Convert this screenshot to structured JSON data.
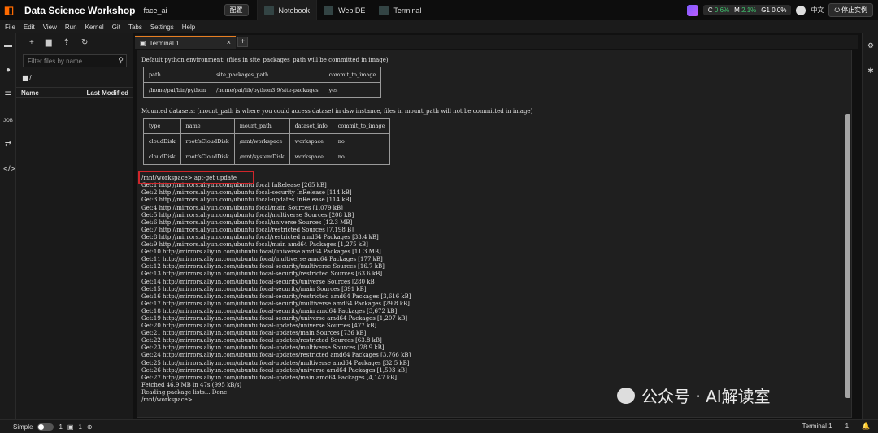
{
  "topbar": {
    "app_title": "Data Science Workshop",
    "workspace": "face_ai",
    "config_button": "配置",
    "tabs": [
      {
        "label": "Notebook",
        "active": true
      },
      {
        "label": "WebIDE",
        "active": false
      },
      {
        "label": "Terminal",
        "active": false
      }
    ],
    "metrics": {
      "c_label": "C",
      "c_value": "0.6%",
      "m_label": "M",
      "m_value": "2.1%",
      "g_label": "G",
      "g_value": "0.0%"
    },
    "language": "中文",
    "stop_button": "停止实例"
  },
  "menu": [
    "File",
    "Edit",
    "View",
    "Run",
    "Kernel",
    "Git",
    "Tabs",
    "Settings",
    "Help"
  ],
  "file_browser": {
    "filter_placeholder": "Filter files by name",
    "path": "/",
    "col_name": "Name",
    "col_modified": "Last Modified"
  },
  "terminal_tab": {
    "label": "Terminal 1"
  },
  "terminal": {
    "env_header": "Default python environment: (files in site_packages_path will be committed in image)",
    "env_table": [
      [
        "path",
        "site_packages_path",
        "commit_to_image"
      ],
      [
        "/home/pai/bin/python",
        "/home/pai/lib/python3.9/site-packages",
        "yes"
      ]
    ],
    "mount_header": "Mounted datasets: (mount_path is where you could access dataset in dsw instance, files in mount_path will not be committed in image)",
    "mount_table": [
      [
        "type",
        "name",
        "mount_path",
        "dataset_info",
        "commit_to_image"
      ],
      [
        "cloudDisk",
        "rootfsCloudDisk",
        "/mnt/workspace",
        "workspace",
        "no"
      ],
      [
        "cloudDisk",
        "rootfsCloudDisk",
        "/mnt/systemDisk",
        "workspace",
        "no"
      ]
    ],
    "command": "/mnt/workspace> apt-get update",
    "output": [
      "Get:1 http://mirrors.aliyun.com/ubuntu focal InRelease [265 kB]",
      "Get:2 http://mirrors.aliyun.com/ubuntu focal-security InRelease [114 kB]",
      "Get:3 http://mirrors.aliyun.com/ubuntu focal-updates InRelease [114 kB]",
      "Get:4 http://mirrors.aliyun.com/ubuntu focal/main Sources [1,079 kB]",
      "Get:5 http://mirrors.aliyun.com/ubuntu focal/multiverse Sources [208 kB]",
      "Get:6 http://mirrors.aliyun.com/ubuntu focal/universe Sources [12.3 MB]",
      "Get:7 http://mirrors.aliyun.com/ubuntu focal/restricted Sources [7,198 B]",
      "Get:8 http://mirrors.aliyun.com/ubuntu focal/restricted amd64 Packages [33.4 kB]",
      "Get:9 http://mirrors.aliyun.com/ubuntu focal/main amd64 Packages [1,275 kB]",
      "Get:10 http://mirrors.aliyun.com/ubuntu focal/universe amd64 Packages [11.3 MB]",
      "Get:11 http://mirrors.aliyun.com/ubuntu focal/multiverse amd64 Packages [177 kB]",
      "Get:12 http://mirrors.aliyun.com/ubuntu focal-security/multiverse Sources [16.7 kB]",
      "Get:13 http://mirrors.aliyun.com/ubuntu focal-security/restricted Sources [63.6 kB]",
      "Get:14 http://mirrors.aliyun.com/ubuntu focal-security/universe Sources [280 kB]",
      "Get:15 http://mirrors.aliyun.com/ubuntu focal-security/main Sources [391 kB]",
      "Get:16 http://mirrors.aliyun.com/ubuntu focal-security/restricted amd64 Packages [3,616 kB]",
      "Get:17 http://mirrors.aliyun.com/ubuntu focal-security/multiverse amd64 Packages [29.8 kB]",
      "Get:18 http://mirrors.aliyun.com/ubuntu focal-security/main amd64 Packages [3,672 kB]",
      "Get:19 http://mirrors.aliyun.com/ubuntu focal-security/universe amd64 Packages [1,207 kB]",
      "Get:20 http://mirrors.aliyun.com/ubuntu focal-updates/universe Sources [477 kB]",
      "Get:21 http://mirrors.aliyun.com/ubuntu focal-updates/main Sources [736 kB]",
      "Get:22 http://mirrors.aliyun.com/ubuntu focal-updates/restricted Sources [63.8 kB]",
      "Get:23 http://mirrors.aliyun.com/ubuntu focal-updates/multiverse Sources [28.9 kB]",
      "Get:24 http://mirrors.aliyun.com/ubuntu focal-updates/restricted amd64 Packages [3,766 kB]",
      "Get:25 http://mirrors.aliyun.com/ubuntu focal-updates/multiverse amd64 Packages [32.5 kB]",
      "Get:26 http://mirrors.aliyun.com/ubuntu focal-updates/universe amd64 Packages [1,503 kB]",
      "Get:27 http://mirrors.aliyun.com/ubuntu focal-updates/main amd64 Packages [4,147 kB]",
      "Fetched 46.9 MB in 47s (995 kB/s)",
      "Reading package lists... Done",
      "/mnt/workspace>"
    ]
  },
  "watermark": "公众号 · AI解读室",
  "statusbar": {
    "mode": "Simple",
    "count1": "1",
    "count2": "1",
    "right_label": "Terminal 1",
    "right_count": "1"
  },
  "colors": {
    "accent": "#e67e22",
    "highlight_box": "#d0262b",
    "metric_green": "#3ec46d"
  },
  "icons": [
    "folder-icon",
    "running-icon",
    "toc-icon",
    "job-icon",
    "git-icon",
    "code-icon",
    "settings-icon",
    "debug-icon",
    "new-folder-icon",
    "upload-icon",
    "refresh-icon",
    "plus-icon",
    "search-icon",
    "terminal-icon",
    "close-icon",
    "globe-icon"
  ]
}
